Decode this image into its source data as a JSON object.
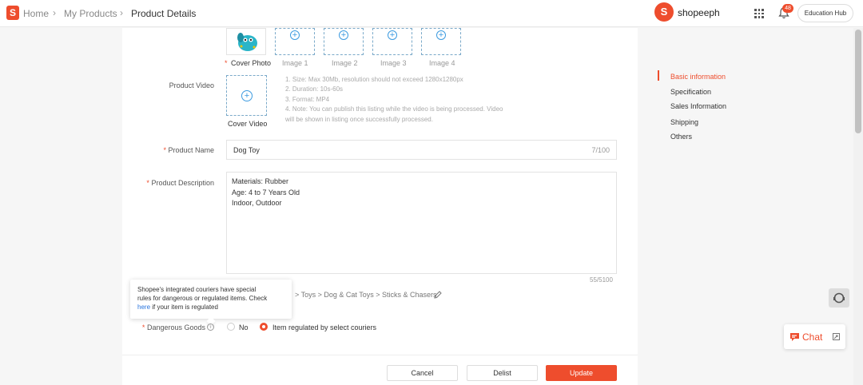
{
  "topbar": {
    "logo_letter": "S",
    "breadcrumb": [
      "Home",
      "My Products",
      "Product Details"
    ],
    "shop_name": "shopeeph",
    "notification_count": "48",
    "education_hub": "Education Hub"
  },
  "media": {
    "cover_label": "Cover Photo",
    "image_labels": [
      "Image 1",
      "Image 2",
      "Image 3",
      "Image 4"
    ],
    "video_label": "Product Video",
    "cover_video_label": "Cover Video",
    "video_notes": [
      "1. Size: Max 30Mb, resolution should not exceed 1280x1280px",
      "2. Duration: 10s-60s",
      "3. Format: MP4",
      "4. Note: You can publish this listing while the video is being processed. Video",
      "will be shown in listing once successfully processed."
    ]
  },
  "form": {
    "name_label": "Product Name",
    "name_value": "Dog Toy",
    "name_counter": "7/100",
    "desc_label": "Product Description",
    "desc_lines": [
      "Materials: Rubber",
      "Age: 4 to 7 Years Old",
      "Indoor, Outdoor"
    ],
    "desc_counter": "55/5100",
    "category_path": "> Toys > Dog & Cat Toys > Sticks & Chasers",
    "dangerous_label": "Dangerous Goods",
    "dangerous_options": [
      "No",
      "Item regulated by select couriers"
    ],
    "dangerous_selected": "Item regulated by select couriers",
    "required_mark": "*"
  },
  "tooltip": {
    "line1": "Shopee's integrated couriers have special",
    "line2": "rules for dangerous or regulated items. Check",
    "link": "here",
    "line3_rest": " if your item is regulated"
  },
  "actions": {
    "cancel": "Cancel",
    "delist": "Delist",
    "update": "Update"
  },
  "side_nav": {
    "items": [
      "Basic information",
      "Specification",
      "Sales Information",
      "Shipping",
      "Others"
    ],
    "active": "Basic information"
  },
  "chat": {
    "label": "Chat"
  },
  "colors": {
    "accent": "#ee4d2d",
    "link": "#2673dd",
    "upload_icon": "#3d9be0"
  }
}
